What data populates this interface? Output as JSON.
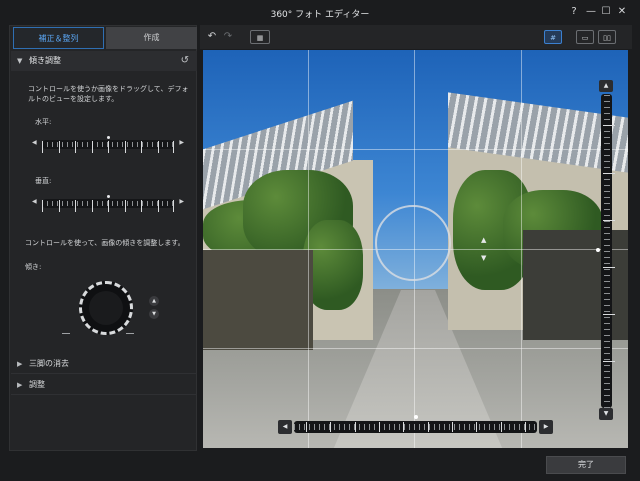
{
  "window": {
    "title": "360° フォト エディター",
    "buttons": {
      "help": "?",
      "minimize": "—",
      "maximize": "☐",
      "close": "✕"
    }
  },
  "tabs": [
    {
      "label": "補正＆整列",
      "active": true
    },
    {
      "label": "作成",
      "active": false
    }
  ],
  "tilt_section": {
    "title": "傾き調整",
    "description": "コントロールを使うか画像をドラッグして、デフォルトのビューを設定します。",
    "horizontal_label": "水平:",
    "horizontal_value": 0.5,
    "vertical_label": "垂直:",
    "vertical_value": 0.5,
    "tilt_description": "コントロールを使って、画像の傾きを調整します。",
    "tilt_label": "傾き:"
  },
  "collapsed_sections": [
    {
      "label": "三脚の消去"
    },
    {
      "label": "調整"
    }
  ],
  "toolbar": {
    "undo": "↶",
    "redo": "↷",
    "filmstrip": "▦",
    "grid": "#",
    "single_view": "▭",
    "split_view": "▯▯"
  },
  "viewer": {
    "vertical_slider_value": 0.5,
    "horizontal_slider_value": 0.5,
    "nav_up": "▲",
    "nav_down": "▼"
  },
  "footer": {
    "done_label": "完了"
  },
  "colors": {
    "accent": "#3b80d0",
    "panel": "#242527",
    "background": "#1b1c1e"
  }
}
